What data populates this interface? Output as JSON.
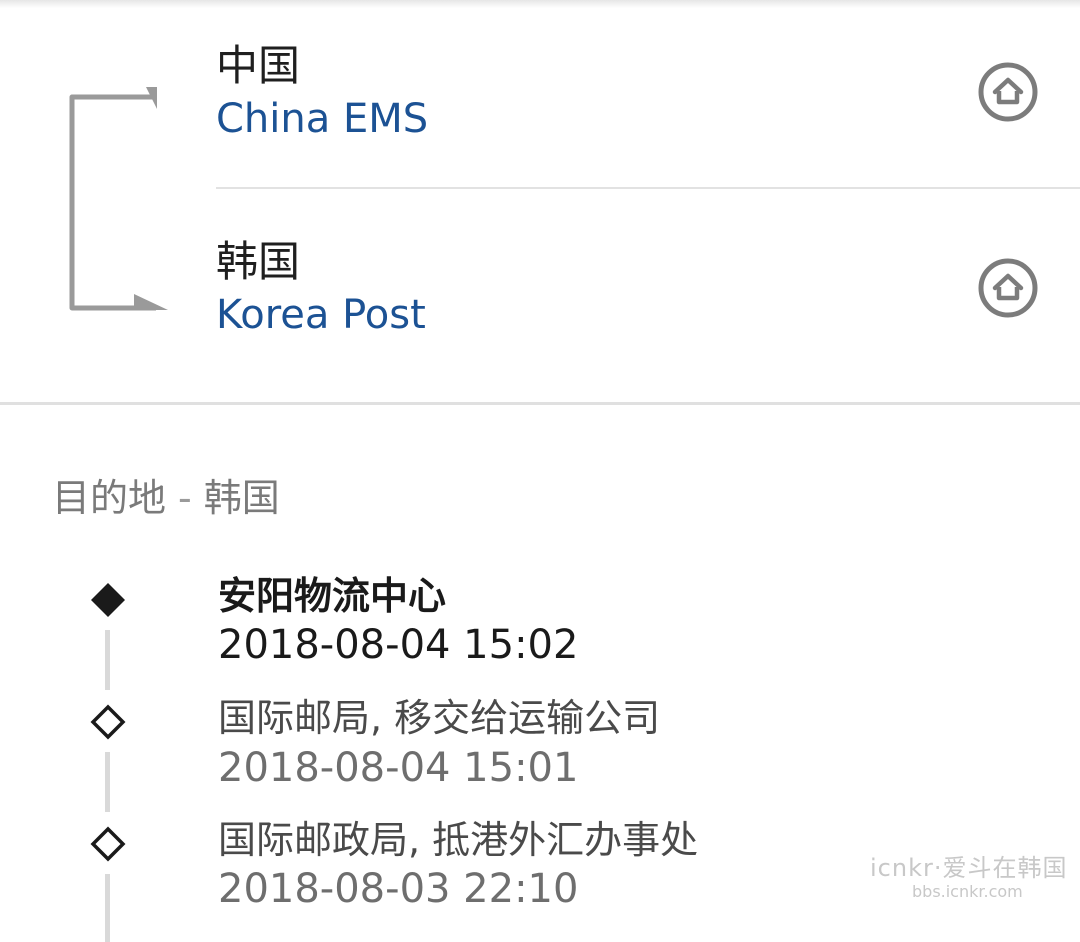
{
  "route": {
    "origin": {
      "country": "中国",
      "carrier": "China EMS",
      "icon": "home-icon"
    },
    "destination": {
      "country": "韩国",
      "carrier": "Korea Post",
      "icon": "home-icon"
    }
  },
  "destination_header": {
    "label": "目的地",
    "separator": "-",
    "country": "韩国"
  },
  "timeline": [
    {
      "title": "安阳物流中心",
      "time": "2018-08-04 15:02",
      "status": "current",
      "icon": "filled-diamond-icon"
    },
    {
      "title": "国际邮局, 移交给运输公司",
      "time": "2018-08-04 15:01",
      "status": "past",
      "icon": "outline-diamond-icon"
    },
    {
      "title": "国际邮政局, 抵港外汇办事处",
      "time": "2018-08-03 22:10",
      "status": "past",
      "icon": "outline-diamond-icon"
    }
  ],
  "watermark": {
    "main": "icnkr·爱斗在韩国",
    "sub": "bbs.icnkr.com"
  },
  "colors": {
    "carrier_text": "#1c5294",
    "bracket": "#9a9a9a",
    "icon_ring": "#7c7c7c",
    "divider": "#e0e0e0",
    "timeline_line": "#d9d9d9"
  }
}
